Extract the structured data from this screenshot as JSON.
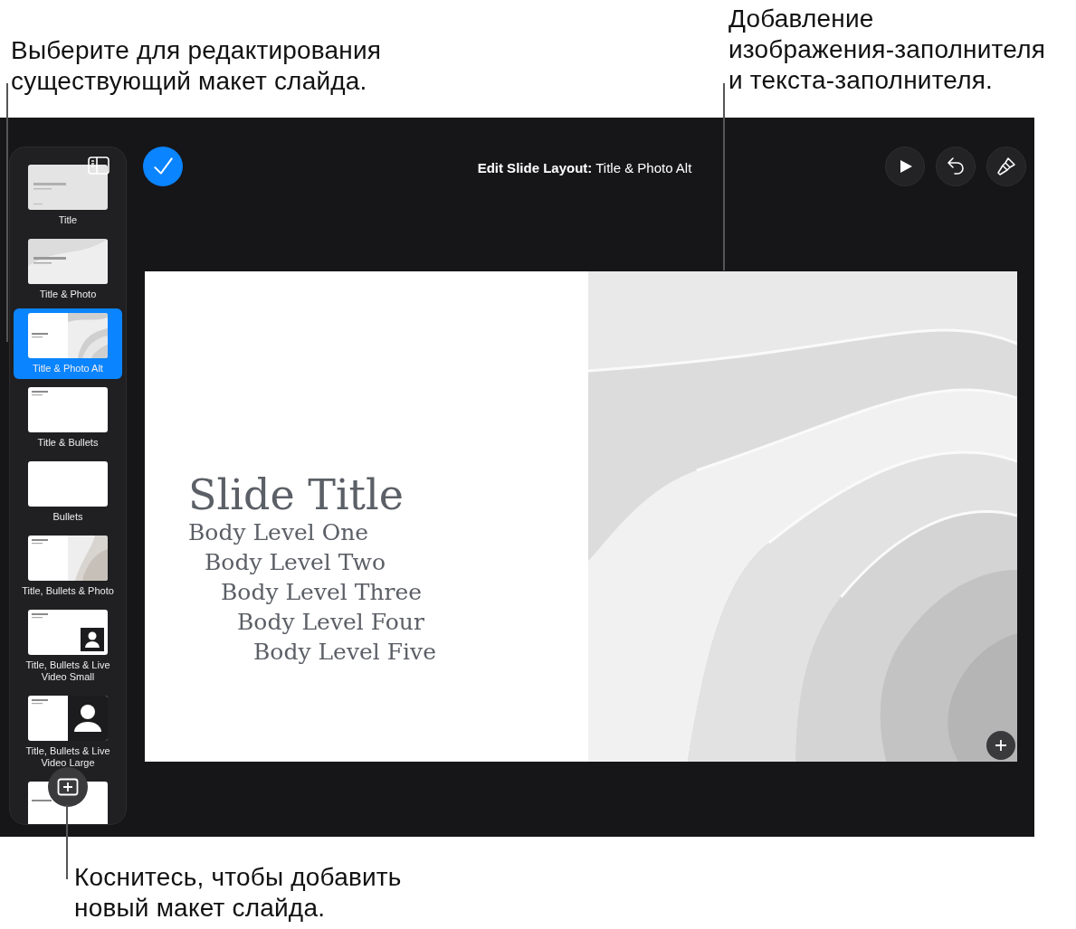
{
  "callouts": [
    {
      "text": "Выберите для редактирования\nсуществующий макет слайда."
    },
    {
      "text": "Добавление\nизображения-заполнителя\nи текста-заполнителя."
    },
    {
      "text": "Коснитесь, чтобы добавить\nновый макет слайда."
    }
  ],
  "layouts": [
    {
      "label": "Title",
      "kind": "title",
      "selected": false
    },
    {
      "label": "Title & Photo",
      "kind": "titlephoto",
      "selected": false
    },
    {
      "label": "Title & Photo Alt",
      "kind": "photoalt",
      "selected": true
    },
    {
      "label": "Title & Bullets",
      "kind": "titlebullets",
      "selected": false
    },
    {
      "label": "Bullets",
      "kind": "blank",
      "selected": false
    },
    {
      "label": "Title, Bullets & Photo",
      "kind": "bulletsphoto",
      "selected": false
    },
    {
      "label": "Title, Bullets & Live Video Small",
      "kind": "videosmall",
      "selected": false
    },
    {
      "label": "Title, Bullets & Live Video Large",
      "kind": "videolarge",
      "selected": false
    },
    {
      "kind": "section",
      "selected": false
    }
  ],
  "toolbar": {
    "title": "**Edit Slide Layout:** Title & Photo Alt"
  },
  "slide": {
    "title": "Slide Title",
    "body": [
      {
        "text": "Body Level One",
        "children": [
          {
            "text": "Body Level Two",
            "children": [
              {
                "text": "Body Level Three",
                "children": [
                  {
                    "text": "Body Level Four",
                    "children": [
                      {
                        "text": "Body Level Five"
                      }
                    ]
                  }
                ]
              }
            ]
          }
        ]
      }
    ]
  }
}
